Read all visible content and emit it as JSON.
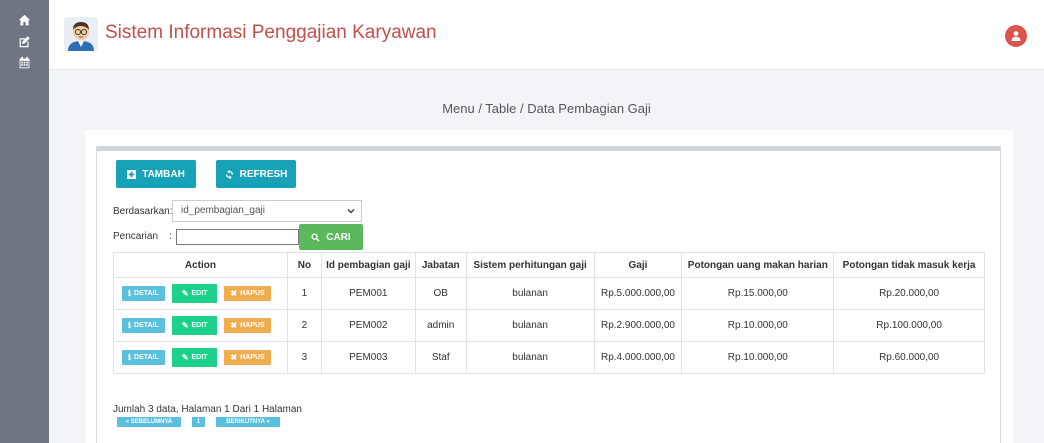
{
  "sidebar": {
    "items": [
      {
        "icon": "home-icon"
      },
      {
        "icon": "edit-icon"
      },
      {
        "icon": "calendar-icon"
      }
    ]
  },
  "header": {
    "title": "Sistem Informasi Penggajian Karyawan",
    "avatar_icon": "user-icon"
  },
  "breadcrumb": "Menu / Table / Data Pembagian Gaji",
  "toolbar": {
    "tambah_label": "TAMBAH",
    "refresh_label": "REFRESH"
  },
  "filter": {
    "berdasarkan_label": "Berdasarkan:",
    "selected_field": "id_pembagian_gaji",
    "pencarian_label": "Pencarian",
    "pencarian_sep": ":",
    "search_value": "",
    "cari_label": "CARI"
  },
  "table": {
    "headers": [
      "Action",
      "No",
      "Id pembagian gaji",
      "Jabatan",
      "Sistem perhitungan gaji",
      "Gaji",
      "Potongan uang makan harian",
      "Potongan tidak masuk kerja"
    ],
    "action_labels": {
      "detail": "DETAIL",
      "edit": "EDIT",
      "hapus": "HAPUS"
    },
    "rows": [
      {
        "no": "1",
        "id": "PEM001",
        "jabatan": "OB",
        "sistem": "bulanan",
        "gaji": "Rp.5.000.000,00",
        "potongan_makan": "Rp.15.000,00",
        "potongan_absen": "Rp.20.000,00"
      },
      {
        "no": "2",
        "id": "PEM002",
        "jabatan": "admin",
        "sistem": "bulanan",
        "gaji": "Rp.2.900.000,00",
        "potongan_makan": "Rp.10.000,00",
        "potongan_absen": "Rp.100.000,00"
      },
      {
        "no": "3",
        "id": "PEM003",
        "jabatan": "Staf",
        "sistem": "bulanan",
        "gaji": "Rp.4.000.000,00",
        "potongan_makan": "Rp.10.000,00",
        "potongan_absen": "Rp.60.000,00"
      }
    ]
  },
  "footer": {
    "info": "Jumlah 3 data, Halaman 1 Dari 1 Halaman",
    "prev_label": "« SEBELUMNYA",
    "page_label": "1",
    "next_label": "BERIKUTNYA »"
  },
  "colors": {
    "sidebar": "#6e7781",
    "title": "#c0504d",
    "primary": "#17a2b8",
    "success": "#5cb85c",
    "info": "#5bc0de",
    "edit": "#1ed18a",
    "warning": "#f0ad4e",
    "avatar": "#d9534f"
  }
}
